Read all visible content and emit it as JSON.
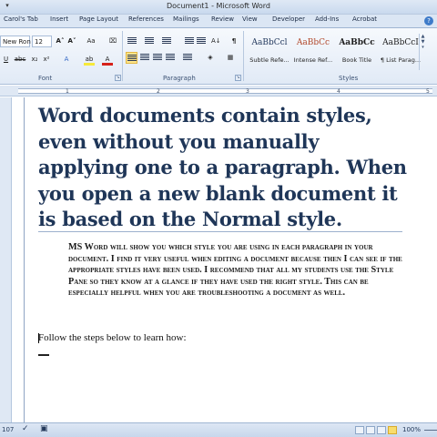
{
  "window": {
    "title": "Document1 - Microsoft Word",
    "qat_icon": "quick-access-menu-icon"
  },
  "tabs": [
    "Carol's Tab",
    "Insert",
    "Page Layout",
    "References",
    "Mailings",
    "Review",
    "View",
    "Developer",
    "Add-Ins",
    "Acrobat"
  ],
  "ribbon": {
    "font": {
      "name": "New Ron",
      "size": "12",
      "group_label": "Font"
    },
    "paragraph": {
      "group_label": "Paragraph"
    },
    "styles": {
      "group_label": "Styles",
      "tiles": [
        {
          "sample": "AaBbCcl",
          "name": "Subtle Refe..."
        },
        {
          "sample": "AaBbCc",
          "name": "Intense Ref..."
        },
        {
          "sample": "AaBbCc",
          "name": "Book Title"
        },
        {
          "sample": "AaBbCcI",
          "name": "¶ List Parag..."
        }
      ]
    }
  },
  "ruler": {
    "numbers": [
      "1",
      "2",
      "3",
      "4",
      "5"
    ]
  },
  "document": {
    "heading": "Word documents contain styles, even without you manually applying one to a paragraph. When you open a new blank document it is based on the Normal style.",
    "quote": "MS Word will show you which style you are using in each paragraph in your document. I find it very useful when editing a document because then I can see if the appropriate styles have been used. I recommend that all my students use the Style Pane so they know at a glance if they have used the right style. This can be especially helpful when you are troubleshooting a document as well.",
    "normal": "Follow the steps below to learn how:"
  },
  "status": {
    "words": "107",
    "zoom": "100%"
  },
  "colors": {
    "heading": "#1f3658",
    "ribbon": "#dbe6f4",
    "highlight": "#fde58a"
  }
}
